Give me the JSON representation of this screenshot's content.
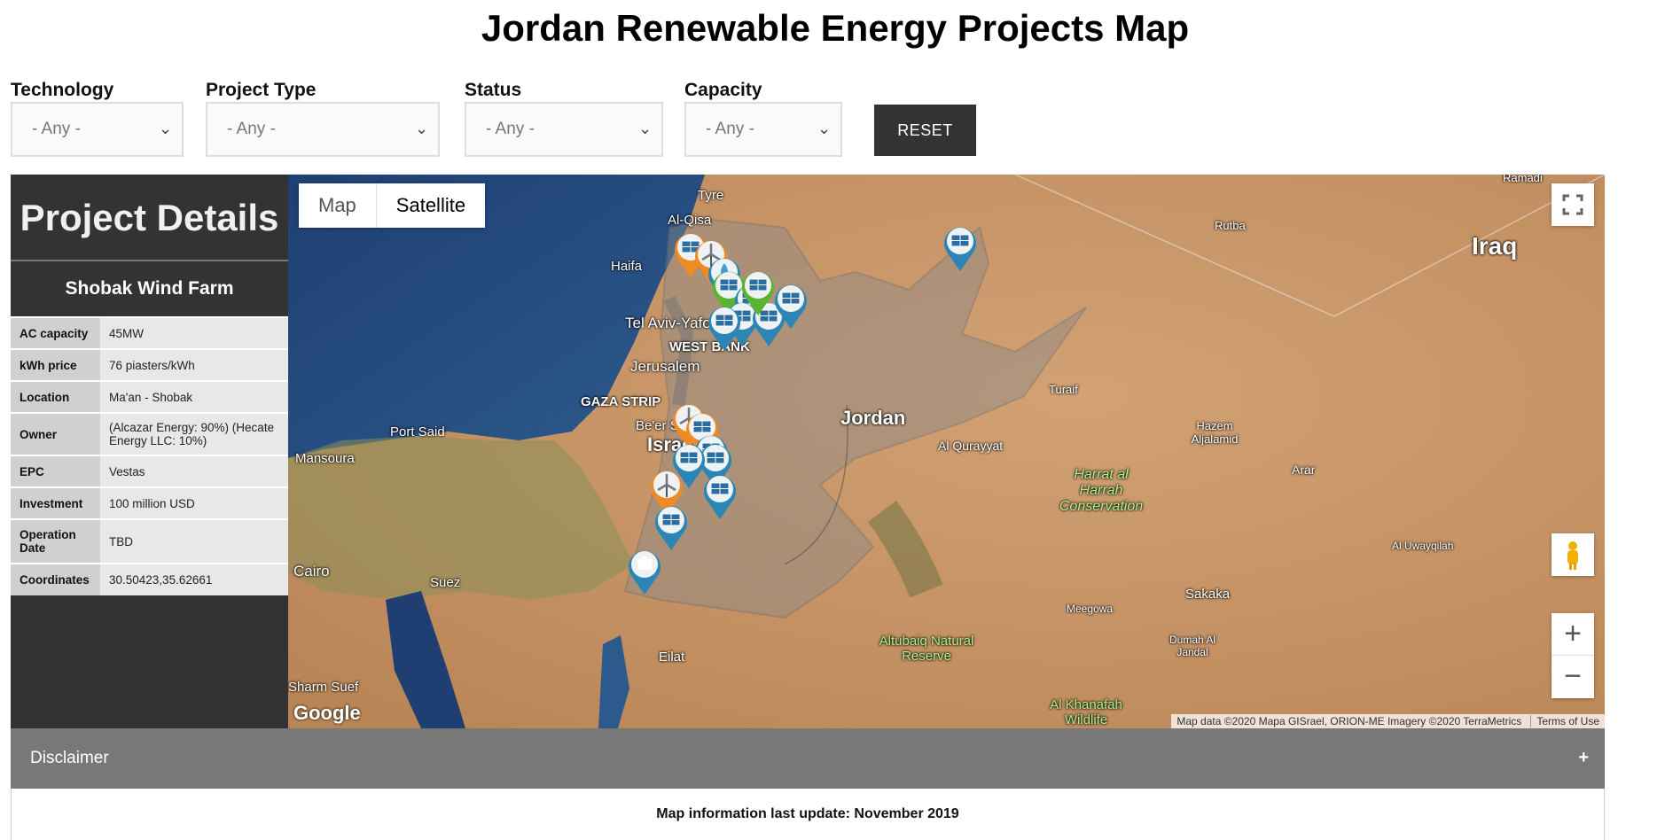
{
  "page": {
    "title": "Jordan Renewable Energy Projects Map"
  },
  "filters": [
    {
      "label": "Technology",
      "value": "- Any -"
    },
    {
      "label": "Project Type",
      "value": "- Any -"
    },
    {
      "label": "Status",
      "value": "- Any -"
    },
    {
      "label": "Capacity",
      "value": "- Any -"
    }
  ],
  "reset_label": "RESET",
  "details": {
    "heading": "Project Details",
    "project_name": "Shobak Wind Farm",
    "rows": [
      {
        "key": "AC capacity",
        "value": "45MW"
      },
      {
        "key": "kWh price",
        "value": "76 piasters/kWh"
      },
      {
        "key": "Location",
        "value": "Ma'an - Shobak"
      },
      {
        "key": "Owner",
        "value": "(Alcazar Energy: 90%) (Hecate Energy LLC: 10%)"
      },
      {
        "key": "EPC",
        "value": "Vestas"
      },
      {
        "key": "Investment",
        "value": "100 million USD"
      },
      {
        "key": "Operation Date",
        "value": "TBD"
      },
      {
        "key": "Coordinates",
        "value": "30.50423,35.62661"
      }
    ]
  },
  "map": {
    "type_control": {
      "map": "Map",
      "satellite": "Satellite"
    },
    "places": {
      "tyre": "Tyre",
      "haifa": "Haifa",
      "tel_aviv": "Tel Aviv-Yafo",
      "west_bank": "WEST BANK",
      "jerusalem": "Jerusalem",
      "gaza": "GAZA STRIP",
      "beer_sheva": "Be'er Sheva",
      "israel": "Israel",
      "jordan": "Jordan",
      "iraq": "Iraq",
      "port_said": "Port Said",
      "mansoura": "Mansoura",
      "cairo": "Cairo",
      "suez": "Suez",
      "eilat": "Eilat",
      "rutba": "Rutba",
      "turaif": "Turaif",
      "al_qurayyat": "Al Qurayyat",
      "hazem": "Hazem Aljalamid",
      "arar": "Arar",
      "harrat": "Harrat al Harrah Conservation",
      "al_uwayqilah": "Al Uwayqilah",
      "sakaka": "Sakaka",
      "meegowa": "Meegowa",
      "dumah": "Dumah Al Jandal",
      "altubaiq": "Altubaiq Natural Reserve",
      "khanafah": "Al Khanafah Wildlife",
      "al_qisa": "Al-Qisa",
      "ramadi": "Ramadi",
      "sharm_fuef": "Sharm Suef"
    },
    "markers": [
      "solar",
      "solar",
      "wind",
      "hydro",
      "solar",
      "solar",
      "solar",
      "solar",
      "solar",
      "solar",
      "wind",
      "wind",
      "solar",
      "solar",
      "solar",
      "solar",
      "solar",
      "solar",
      "storage",
      "solar"
    ],
    "google_logo": "Google",
    "attribution": "Map data ©2020 Mapa GISrael, ORION-ME Imagery ©2020 TerraMetrics",
    "terms": "Terms of Use",
    "zoom_in": "+",
    "zoom_out": "−"
  },
  "disclaimer": {
    "label": "Disclaimer",
    "toggle": "+"
  },
  "footer": {
    "update": "Map information last update: November 2019"
  },
  "colors": {
    "dark_panel": "#333333",
    "disclaimer_bar": "#787878",
    "marker_blue": "#2b86b5",
    "marker_orange": "#f08a24",
    "marker_green": "#5ab430"
  }
}
